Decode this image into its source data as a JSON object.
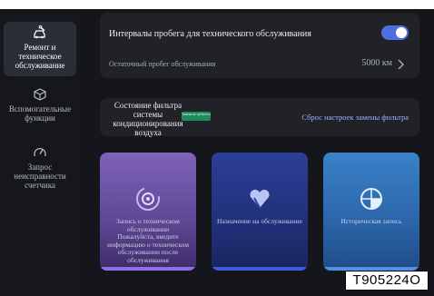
{
  "sidebar": {
    "items": [
      {
        "label": "Ремонт и техническое обслуживание",
        "icon": "car-wrench-icon",
        "active": true
      },
      {
        "label": "Вспомогательные функции",
        "icon": "cube-icon",
        "active": false
      },
      {
        "label": "Запрос неисправности счетчика",
        "icon": "gauge-icon",
        "active": false
      }
    ]
  },
  "service_interval": {
    "title": "Интервалы пробега для технического обслуживания",
    "toggle_on": true,
    "remaining_label": "Остаточный пробег обслуживания",
    "remaining_value": "5000 км"
  },
  "filter": {
    "title": "Состояние фильтра системы кондиционирования воздуха",
    "badge": "Замена не требуется",
    "reset_link": "Сброс настроек замены фильтра"
  },
  "cards": [
    {
      "label": "Запись о техническом обслуживании",
      "description": "Пожалуйста, введите информацию о техническом обслуживании после обслуживания",
      "icon": "record-icon"
    },
    {
      "label": "Назначение на обслуживание",
      "description": "",
      "icon": "appointment-heart-icon"
    },
    {
      "label": "Историческая запись",
      "description": "",
      "icon": "history-globe-icon"
    }
  ],
  "image_code": "T905224O",
  "colors": {
    "background": "#14161b",
    "panel": "#202228",
    "toggle_accent": "#4f6fe0",
    "badge_green": "#1f8a5a",
    "link_blue": "#9fb1ff"
  }
}
